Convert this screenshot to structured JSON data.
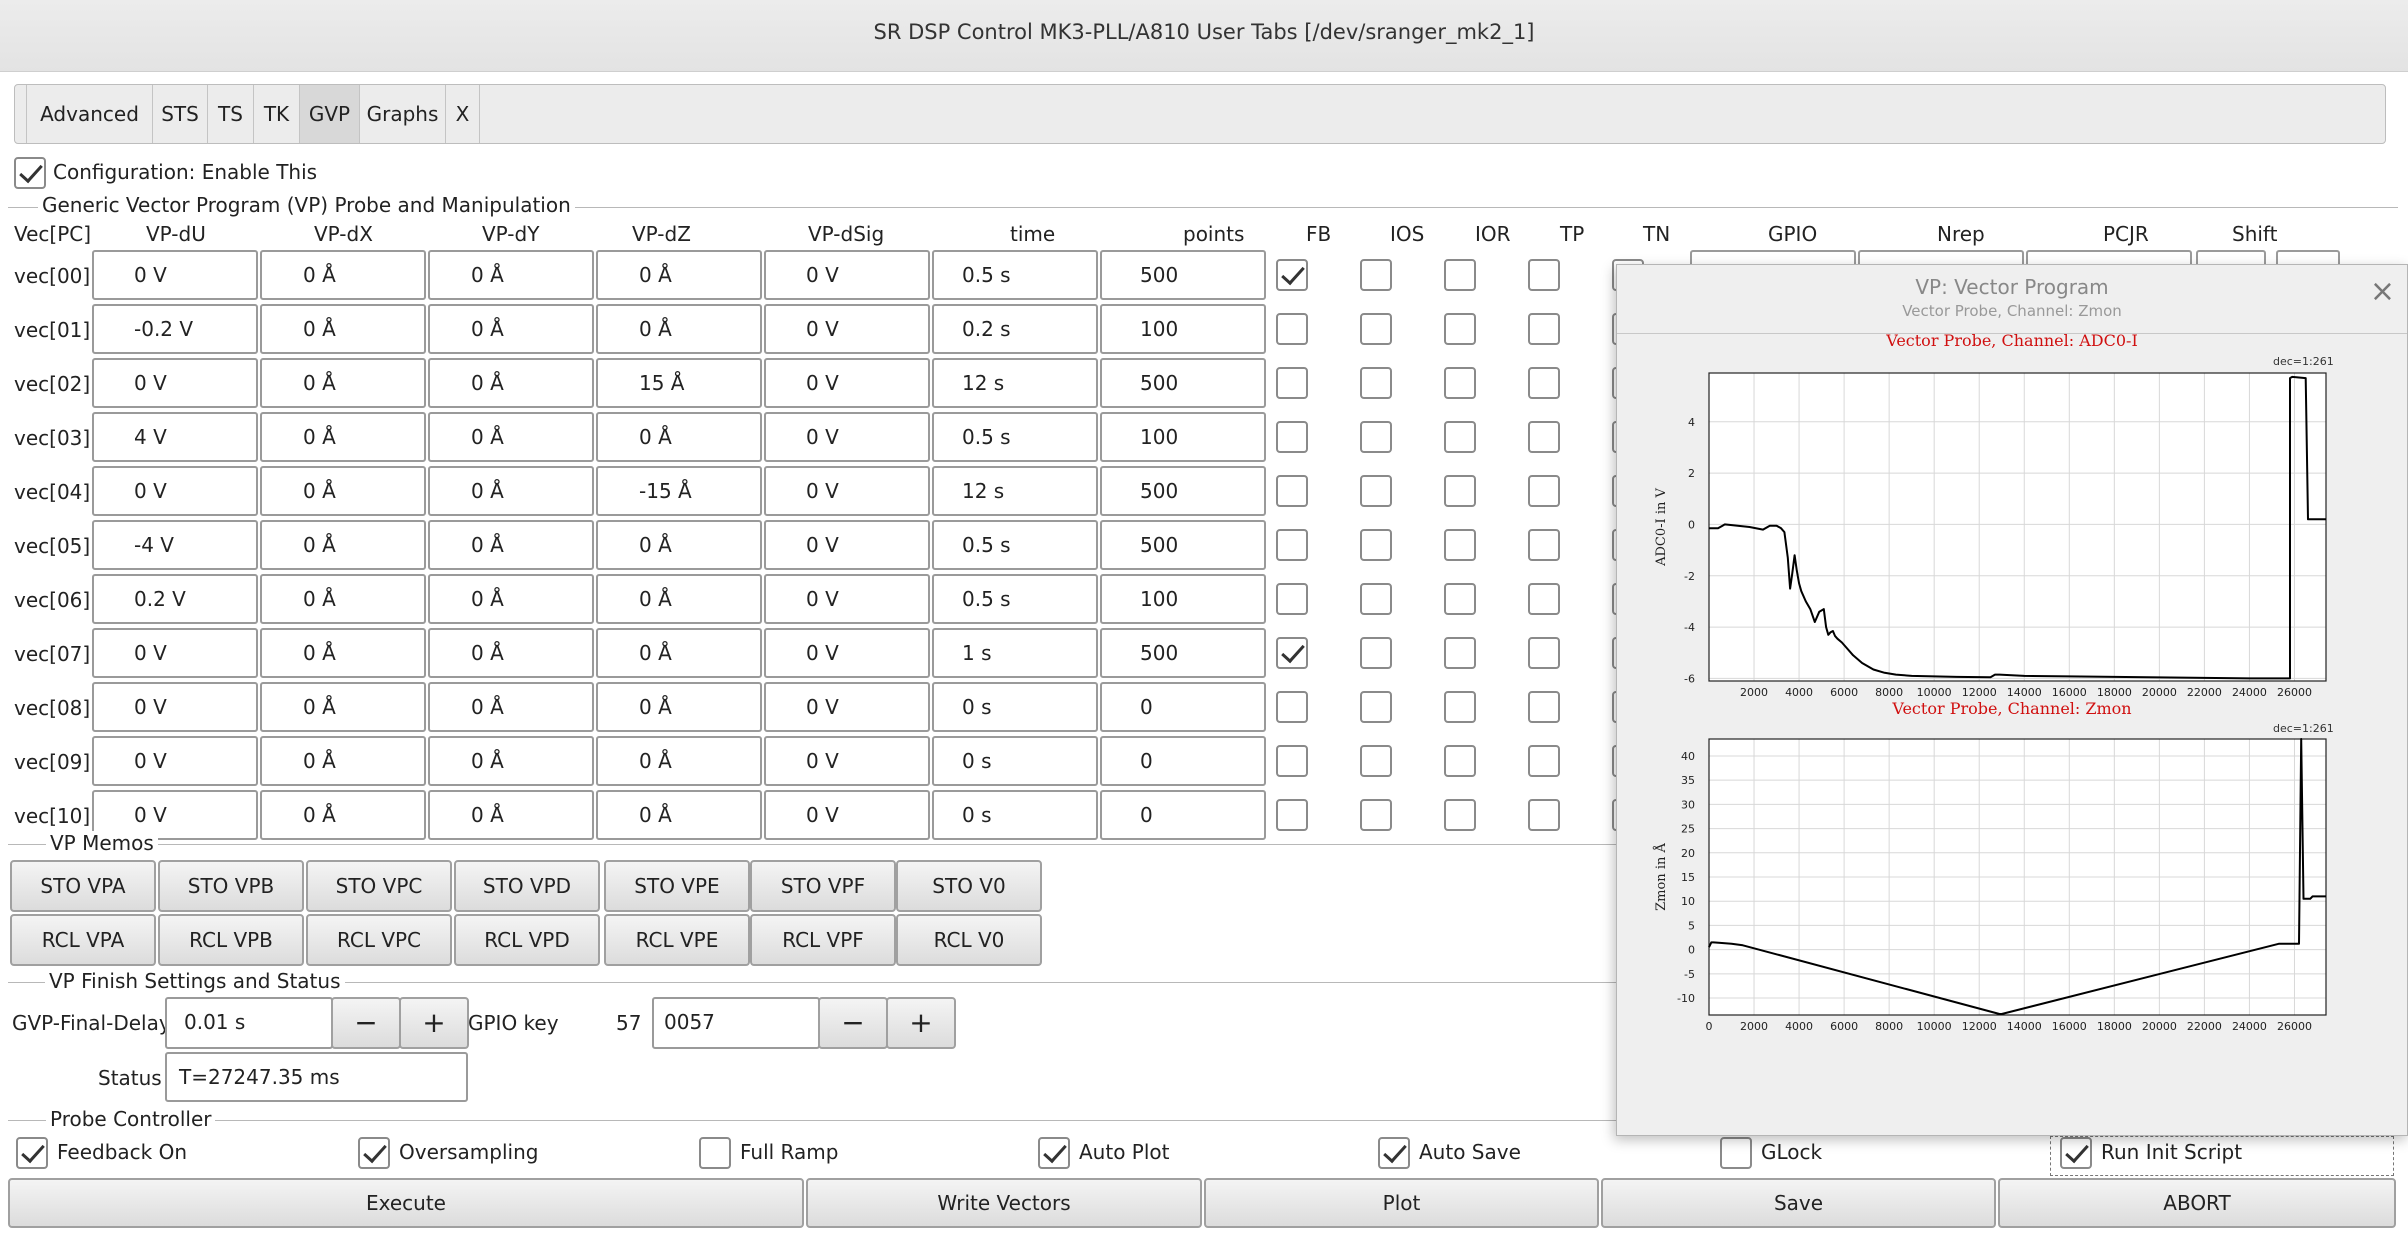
{
  "window": {
    "title": "SR DSP Control MK3-PLL/A810 User Tabs [/dev/sranger_mk2_1]"
  },
  "tabs": [
    {
      "label": "Advanced"
    },
    {
      "label": "STS"
    },
    {
      "label": "TS"
    },
    {
      "label": "TK"
    },
    {
      "label": "GVP",
      "active": true
    },
    {
      "label": "Graphs"
    },
    {
      "label": "X"
    }
  ],
  "config": {
    "enable_label": "Configuration: Enable This",
    "checked": true
  },
  "gvp_section": {
    "title": "Generic Vector Program (VP) Probe and Manipulation"
  },
  "table": {
    "headers": [
      "Vec[PC]",
      "VP-dU",
      "VP-dX",
      "VP-dY",
      "VP-dZ",
      "VP-dSig",
      "time",
      "points",
      "FB",
      "IOS",
      "IOR",
      "TP",
      "TN",
      "GPIO",
      "Nrep",
      "PCJR",
      "Shift"
    ],
    "rows": [
      {
        "vec": "vec[00]",
        "du": "0 V",
        "dx": "0 Å",
        "dy": "0 Å",
        "dz": "0 Å",
        "dsig": "0 V",
        "time": "0.5 s",
        "points": "500",
        "fb": true
      },
      {
        "vec": "vec[01]",
        "du": "-0.2 V",
        "dx": "0 Å",
        "dy": "0 Å",
        "dz": "0 Å",
        "dsig": "0 V",
        "time": "0.2 s",
        "points": "100",
        "fb": false
      },
      {
        "vec": "vec[02]",
        "du": "0 V",
        "dx": "0 Å",
        "dy": "0 Å",
        "dz": "15 Å",
        "dsig": "0 V",
        "time": "12 s",
        "points": "500",
        "fb": false
      },
      {
        "vec": "vec[03]",
        "du": "4 V",
        "dx": "0 Å",
        "dy": "0 Å",
        "dz": "0 Å",
        "dsig": "0 V",
        "time": "0.5 s",
        "points": "100",
        "fb": false
      },
      {
        "vec": "vec[04]",
        "du": "0 V",
        "dx": "0 Å",
        "dy": "0 Å",
        "dz": "-15 Å",
        "dsig": "0 V",
        "time": "12 s",
        "points": "500",
        "fb": false
      },
      {
        "vec": "vec[05]",
        "du": "-4 V",
        "dx": "0 Å",
        "dy": "0 Å",
        "dz": "0 Å",
        "dsig": "0 V",
        "time": "0.5 s",
        "points": "500",
        "fb": false
      },
      {
        "vec": "vec[06]",
        "du": "0.2 V",
        "dx": "0 Å",
        "dy": "0 Å",
        "dz": "0 Å",
        "dsig": "0 V",
        "time": "0.5 s",
        "points": "100",
        "fb": false
      },
      {
        "vec": "vec[07]",
        "du": "0 V",
        "dx": "0 Å",
        "dy": "0 Å",
        "dz": "0 Å",
        "dsig": "0 V",
        "time": "1 s",
        "points": "500",
        "fb": true
      },
      {
        "vec": "vec[08]",
        "du": "0 V",
        "dx": "0 Å",
        "dy": "0 Å",
        "dz": "0 Å",
        "dsig": "0 V",
        "time": "0 s",
        "points": "0",
        "fb": false
      },
      {
        "vec": "vec[09]",
        "du": "0 V",
        "dx": "0 Å",
        "dy": "0 Å",
        "dz": "0 Å",
        "dsig": "0 V",
        "time": "0 s",
        "points": "0",
        "fb": false
      },
      {
        "vec": "vec[10]",
        "du": "0 V",
        "dx": "0 Å",
        "dy": "0 Å",
        "dz": "0 Å",
        "dsig": "0 V",
        "time": "0 s",
        "points": "0",
        "fb": false
      }
    ]
  },
  "memos": {
    "title": "VP Memos",
    "sto": [
      "STO VPA",
      "STO VPB",
      "STO VPC",
      "STO VPD",
      "STO VPE",
      "STO VPF",
      "STO V0"
    ],
    "rcl": [
      "RCL VPA",
      "RCL VPB",
      "RCL VPC",
      "RCL VPD",
      "RCL VPE",
      "RCL VPF",
      "RCL V0"
    ]
  },
  "finish": {
    "title": "VP Finish Settings and Status",
    "delay_label": "GVP-Final-Delay",
    "delay_value": "0.01 s",
    "minus": "−",
    "plus": "+",
    "gpio_label": "GPIO key",
    "gpio_num": "57",
    "gpio_value": "0057",
    "status_label": "Status",
    "status_value": "T=27247.35 ms"
  },
  "probe": {
    "title": "Probe Controller",
    "options": [
      {
        "label": "Feedback On",
        "checked": true
      },
      {
        "label": "Oversampling",
        "checked": true
      },
      {
        "label": "Full Ramp",
        "checked": false
      },
      {
        "label": "Auto Plot",
        "checked": true
      },
      {
        "label": "Auto Save",
        "checked": true
      },
      {
        "label": "GLock",
        "checked": false
      },
      {
        "label": "Run Init Script",
        "checked": true
      }
    ],
    "actions": [
      "Execute",
      "Write Vectors",
      "Plot",
      "Save",
      "ABORT"
    ]
  },
  "popup": {
    "title": "VP: Vector Program",
    "subtitle": "Vector Probe, Channel: Zmon",
    "close": "×"
  },
  "chart_data": [
    {
      "type": "line",
      "title": "Vector Probe, Channel: ADC0-I",
      "annotation": "dec=1:261",
      "xlabel": "",
      "ylabel": "ADC0-I in V",
      "xlim": [
        0,
        27400
      ],
      "ylim": [
        -6.1,
        5.9
      ],
      "xticks": [
        2000,
        4000,
        6000,
        8000,
        10000,
        12000,
        14000,
        16000,
        18000,
        20000,
        22000,
        24000,
        26000
      ],
      "yticks": [
        -6,
        -4,
        -2,
        0,
        2,
        4
      ],
      "grid": true,
      "series": [
        {
          "x": [
            0,
            400,
            600,
            700,
            1800,
            2400,
            2700,
            3000,
            3200,
            3350,
            3500,
            3600,
            3700,
            3800,
            3900,
            4000,
            4100,
            4300,
            4500,
            4700,
            4900,
            5100,
            5200,
            5300,
            5400,
            5500,
            5600,
            5700,
            5900,
            6100,
            6400,
            6800,
            7300,
            7800,
            8300,
            9000,
            10000,
            11000,
            12500,
            12700,
            12900,
            14000,
            16000,
            18000,
            20000,
            22000,
            24000,
            25800,
            25800,
            25900,
            26500,
            26600,
            26700,
            27400
          ],
          "y": [
            -0.15,
            -0.15,
            -0.05,
            0.0,
            -0.1,
            -0.2,
            -0.05,
            -0.05,
            -0.15,
            -0.3,
            -1.3,
            -2.5,
            -1.9,
            -1.2,
            -1.8,
            -2.3,
            -2.6,
            -3.0,
            -3.3,
            -3.8,
            -3.4,
            -3.3,
            -4.0,
            -4.3,
            -4.2,
            -4.15,
            -4.35,
            -4.45,
            -4.6,
            -4.8,
            -5.1,
            -5.4,
            -5.65,
            -5.78,
            -5.85,
            -5.9,
            -5.92,
            -5.94,
            -5.95,
            -5.85,
            -5.85,
            -5.9,
            -5.92,
            -5.94,
            -5.96,
            -5.98,
            -6.0,
            -6.0,
            5.7,
            5.75,
            5.7,
            0.2,
            0.2,
            0.2
          ]
        }
      ]
    },
    {
      "type": "line",
      "title": "Vector Probe, Channel: Zmon",
      "annotation": "dec=1:261",
      "xlabel": "",
      "ylabel": "Zmon in Å",
      "xlim": [
        0,
        27400
      ],
      "ylim": [
        -13.5,
        43.5
      ],
      "xticks": [
        0,
        2000,
        4000,
        6000,
        8000,
        10000,
        12000,
        14000,
        16000,
        18000,
        20000,
        22000,
        24000,
        26000
      ],
      "yticks": [
        -10,
        -5,
        0,
        5,
        10,
        15,
        20,
        25,
        30,
        35,
        40
      ],
      "grid": true,
      "series": [
        {
          "x": [
            0,
            100,
            200,
            500,
            1000,
            1500,
            12900,
            13000,
            25300,
            25400,
            26200,
            26300,
            26400,
            26700,
            26800,
            26900,
            27400
          ],
          "y": [
            0.5,
            1.5,
            1.5,
            1.4,
            1.2,
            0.9,
            -13.3,
            -13.3,
            1.2,
            1.2,
            1.2,
            43.5,
            10.5,
            10.5,
            11.0,
            11.0,
            11.0
          ]
        }
      ]
    }
  ]
}
